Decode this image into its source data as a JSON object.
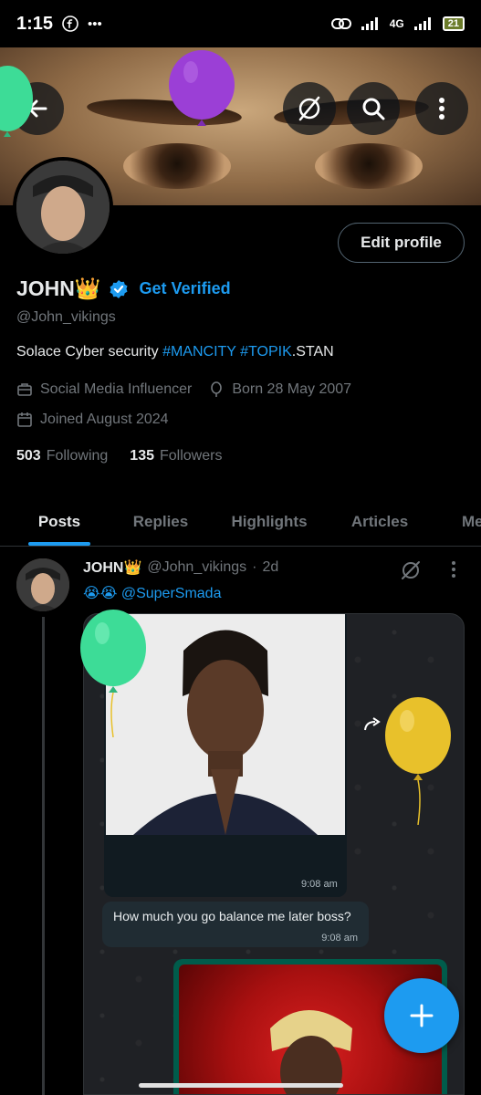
{
  "status_bar": {
    "time": "1:15",
    "network": "4G",
    "battery": "21"
  },
  "profile": {
    "display_name": "JOHN",
    "name_emoji": "👑",
    "get_verified_label": "Get Verified",
    "handle": "@John_vikings",
    "bio_prefix": "Solace Cyber security ",
    "bio_tag1": "#MANCITY",
    "bio_space": " ",
    "bio_tag2": "#TOPIK",
    "bio_suffix": ".STAN",
    "category": "Social Media Influencer",
    "born": "Born 28 May 2007",
    "joined": "Joined August 2024",
    "following_count": "503",
    "following_label": "Following",
    "followers_count": "135",
    "followers_label": "Followers",
    "edit_profile_label": "Edit profile"
  },
  "tabs": [
    {
      "label": "Posts",
      "active": true
    },
    {
      "label": "Replies",
      "active": false
    },
    {
      "label": "Highlights",
      "active": false
    },
    {
      "label": "Articles",
      "active": false
    },
    {
      "label": "Me",
      "active": false
    }
  ],
  "post": {
    "author_name": "JOHN",
    "author_emoji": "👑",
    "author_handle": "@John_vikings",
    "separator": "·",
    "age": "2d",
    "emojis": "😭😭",
    "mention": "@SuperSmada",
    "media": {
      "image_time": "9:08 am",
      "bubble_text": "How much you go balance me later boss?",
      "bubble_time": "9:08 am"
    }
  },
  "colors": {
    "accent": "#1d9bf0",
    "balloon_green": "#3ddc97",
    "balloon_purple": "#9b3fd6",
    "balloon_yellow": "#e8c12b"
  },
  "icons": {
    "back": "arrow-left-icon",
    "grok": "grok-icon",
    "search": "search-icon",
    "more": "more-vertical-icon",
    "verified": "verified-badge-icon",
    "briefcase": "briefcase-icon",
    "balloon": "birthday-balloon-icon",
    "calendar": "calendar-icon",
    "compose": "plus-icon"
  }
}
